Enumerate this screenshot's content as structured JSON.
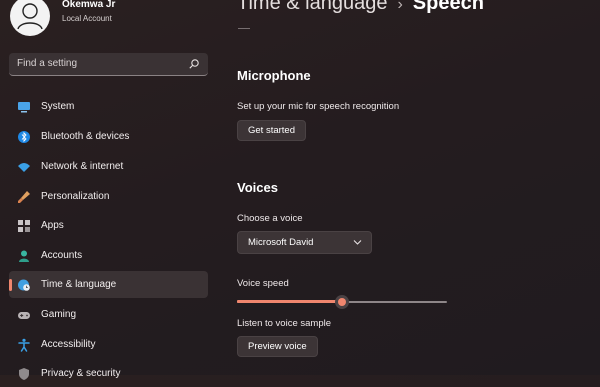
{
  "user": {
    "name": "Okemwa Jr",
    "account_type": "Local Account"
  },
  "search": {
    "placeholder": "Find a setting"
  },
  "sidebar": {
    "items": [
      {
        "label": "System",
        "icon": "monitor-icon"
      },
      {
        "label": "Bluetooth & devices",
        "icon": "bluetooth-icon"
      },
      {
        "label": "Network & internet",
        "icon": "wifi-icon"
      },
      {
        "label": "Personalization",
        "icon": "brush-icon"
      },
      {
        "label": "Apps",
        "icon": "apps-icon"
      },
      {
        "label": "Accounts",
        "icon": "person-icon"
      },
      {
        "label": "Time & language",
        "icon": "globe-clock-icon",
        "selected": true
      },
      {
        "label": "Gaming",
        "icon": "gamepad-icon"
      },
      {
        "label": "Accessibility",
        "icon": "accessibility-icon"
      },
      {
        "label": "Privacy & security",
        "icon": "shield-icon"
      }
    ]
  },
  "breadcrumb": {
    "parent": "Time & language",
    "separator": "›",
    "current": "Speech"
  },
  "microphone": {
    "heading": "Microphone",
    "description": "Set up your mic for speech recognition",
    "button_label": "Get started"
  },
  "voices": {
    "heading": "Voices",
    "choose_label": "Choose a voice",
    "selected_voice": "Microsoft David",
    "speed_label": "Voice speed",
    "speed_value": 0.5,
    "sample_label": "Listen to voice sample",
    "preview_button": "Preview voice"
  },
  "colors": {
    "accent": "#f0866e",
    "background": "#241c1f",
    "surface": "#3a3234"
  }
}
